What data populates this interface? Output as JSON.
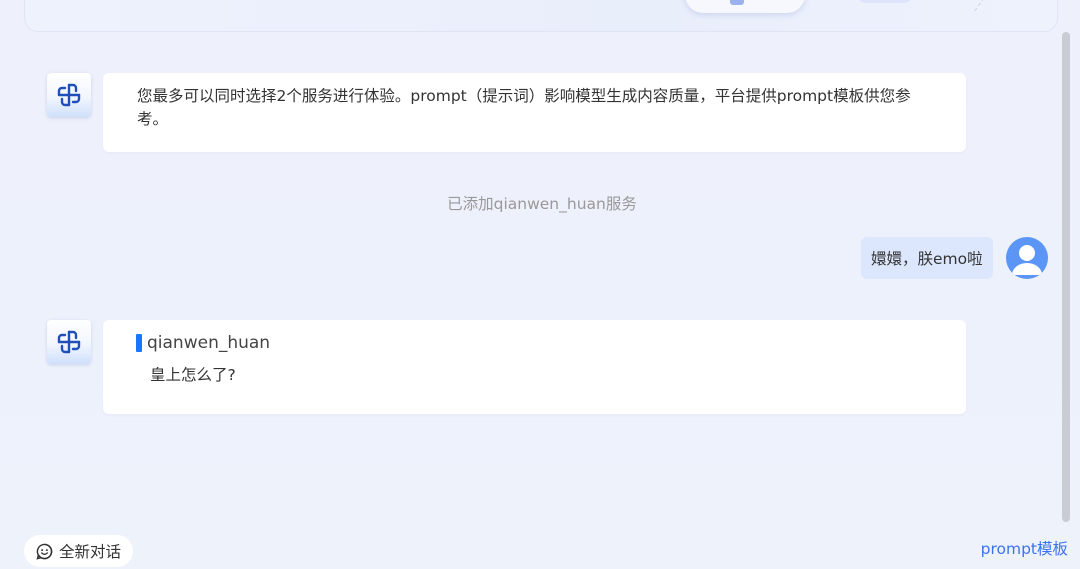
{
  "messages": {
    "intro": "您最多可以同时选择2个服务进行体验。prompt（提示词）影响模型生成内容质量，平台提供prompt模板供您参考。",
    "system_note": "已添加qianwen_huan服务",
    "user_message": "嬛嬛，朕emo啦",
    "reply_name": "qianwen_huan",
    "reply_text": "皇上怎么了?"
  },
  "footer": {
    "new_chat_label": "全新对话",
    "prompt_template_label": "prompt模板"
  },
  "colors": {
    "accent": "#1677ff",
    "link": "#3b74f0",
    "user_bubble": "#dce7fd",
    "avatar_bg": "#5b96f6"
  },
  "icons": {
    "bot_avatar": "bot-logo-icon",
    "user_avatar": "user-avatar-icon",
    "new_chat": "smiley-chat-icon"
  }
}
